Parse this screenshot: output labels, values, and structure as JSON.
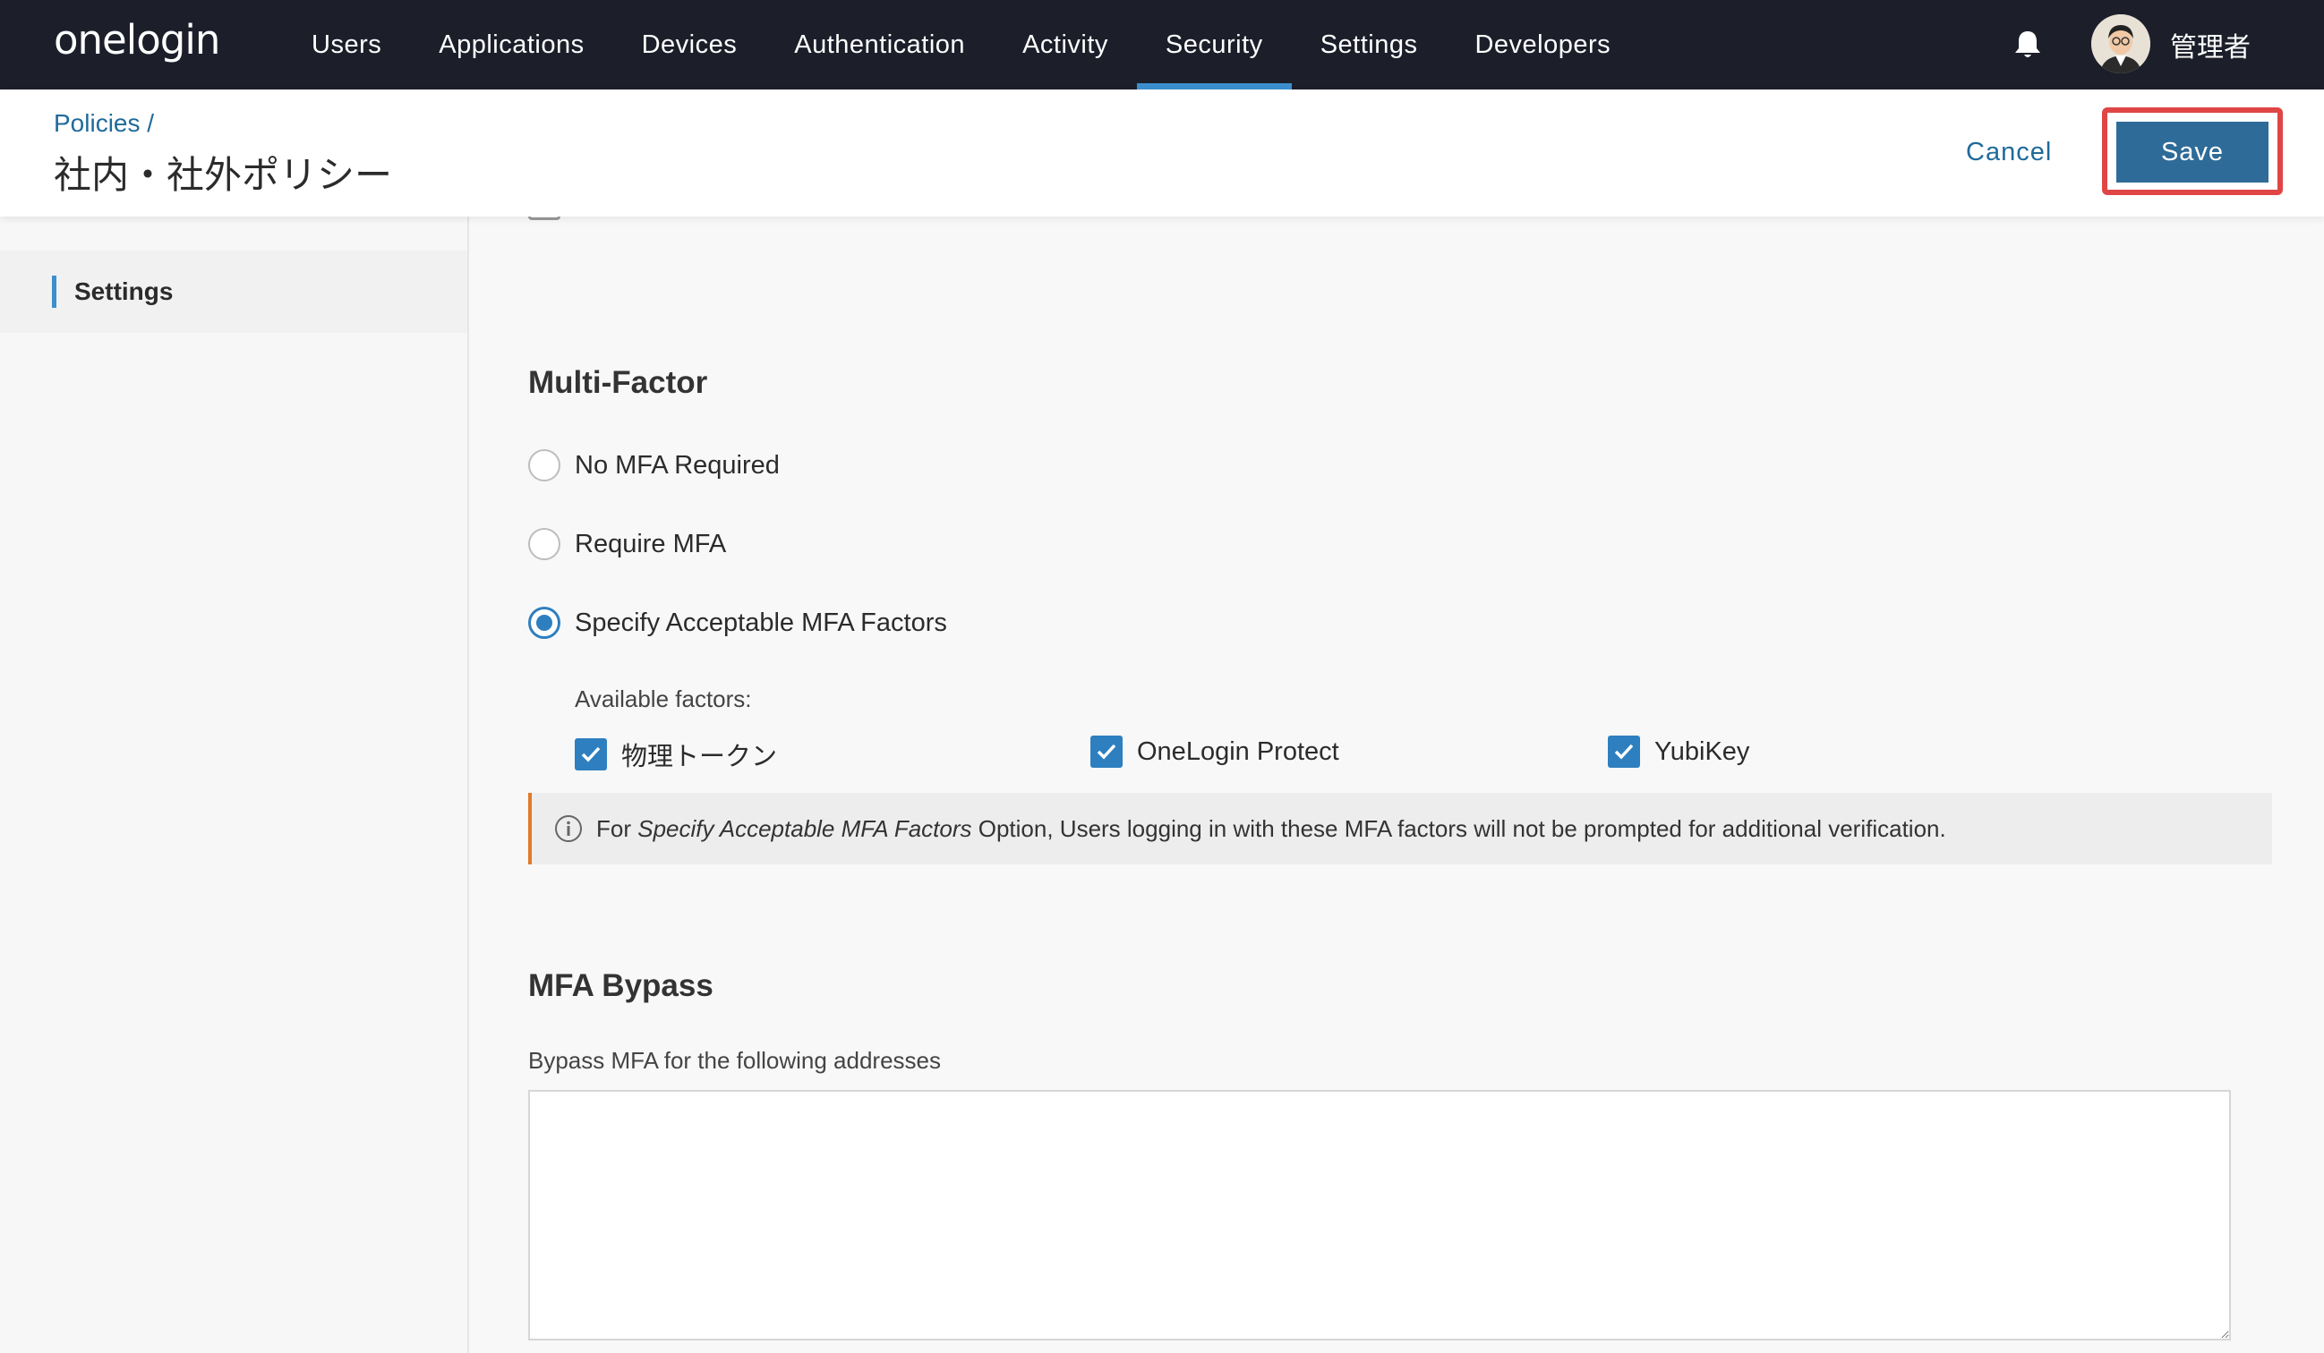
{
  "nav": {
    "logo": "onelogin",
    "items": [
      {
        "label": "Users"
      },
      {
        "label": "Applications"
      },
      {
        "label": "Devices"
      },
      {
        "label": "Authentication"
      },
      {
        "label": "Activity"
      },
      {
        "label": "Security",
        "active": true
      },
      {
        "label": "Settings"
      },
      {
        "label": "Developers"
      }
    ],
    "username": "管理者",
    "accent_color": "#3b8fce"
  },
  "header": {
    "breadcrumb": "Policies /",
    "title": "社内・社外ポリシー",
    "cancel_label": "Cancel",
    "save_label": "Save",
    "save_highlight_color": "#e04545"
  },
  "sidebar": {
    "items": [
      {
        "label": "Settings",
        "active": true
      }
    ]
  },
  "multi_factor": {
    "title": "Multi-Factor",
    "options": [
      {
        "label": "No MFA Required",
        "checked": false
      },
      {
        "label": "Require MFA",
        "checked": false
      },
      {
        "label": "Specify Acceptable MFA Factors",
        "checked": true
      }
    ],
    "factors_label": "Available factors:",
    "factors": [
      {
        "label": "物理トークン",
        "checked": true
      },
      {
        "label": "OneLogin Protect",
        "checked": true
      },
      {
        "label": "YubiKey",
        "checked": true
      }
    ],
    "info": {
      "prefix": "For ",
      "emphasis": "Specify Acceptable MFA Factors",
      "suffix": " Option, Users logging in with these MFA factors will not be prompted for additional verification."
    }
  },
  "mfa_bypass": {
    "title": "MFA Bypass",
    "field_label": "Bypass MFA for the following addresses",
    "value": ""
  }
}
